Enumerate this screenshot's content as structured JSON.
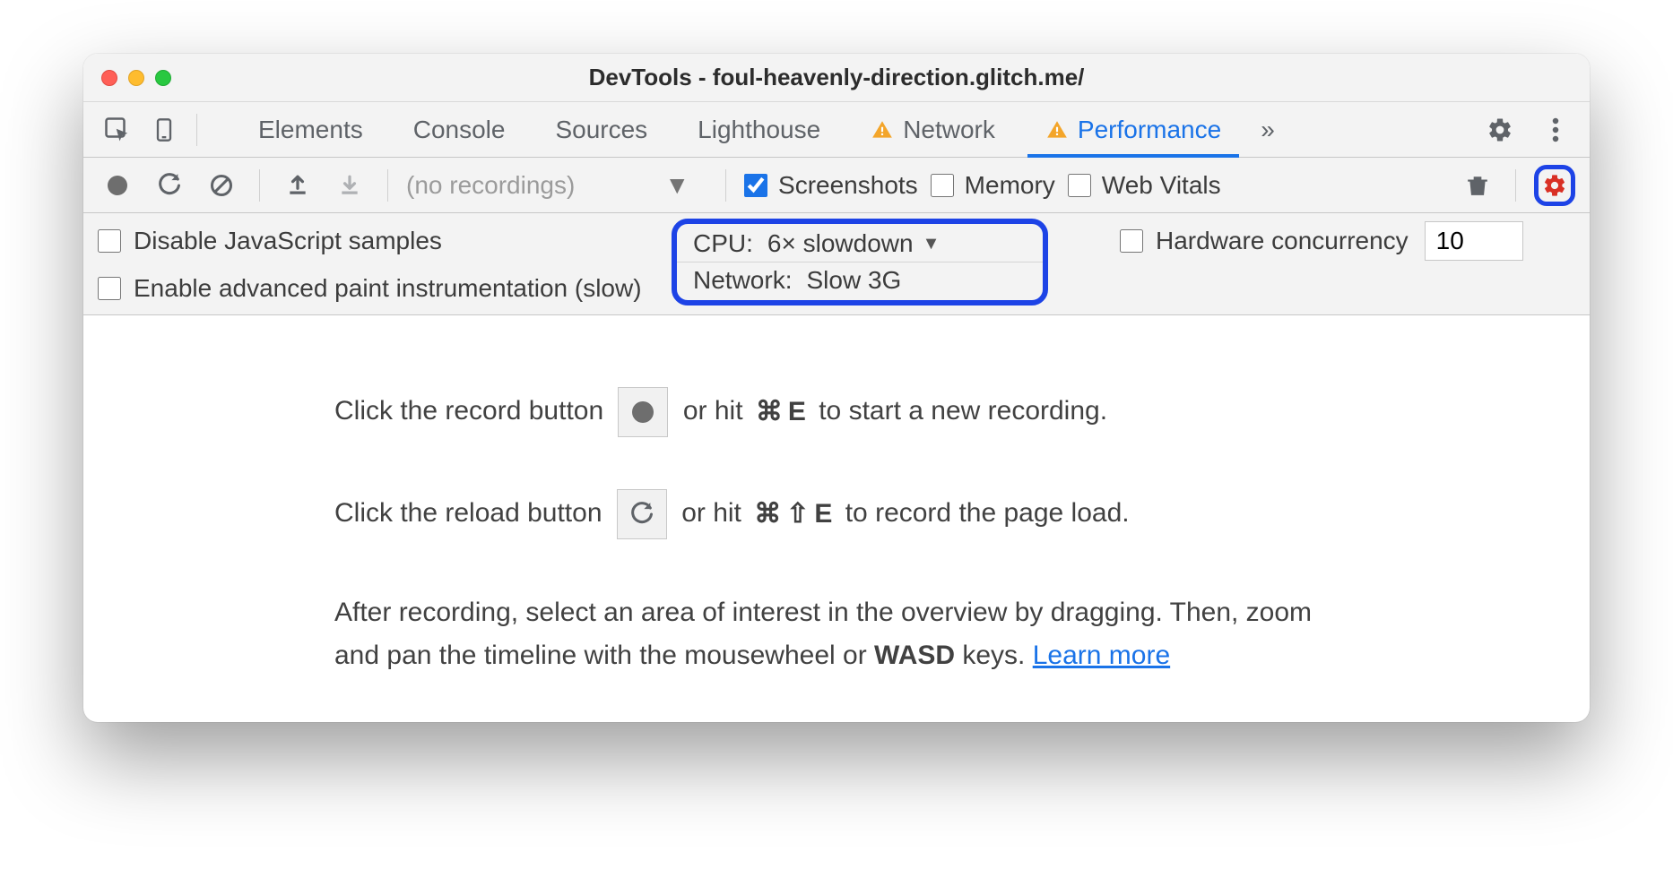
{
  "titlebar": {
    "title": "DevTools - foul-heavenly-direction.glitch.me/"
  },
  "tabs": {
    "items": [
      {
        "label": "Elements"
      },
      {
        "label": "Console"
      },
      {
        "label": "Sources"
      },
      {
        "label": "Lighthouse"
      },
      {
        "label": "Network",
        "warn": true
      },
      {
        "label": "Performance",
        "warn": true,
        "active": true
      }
    ],
    "more_glyph": "»"
  },
  "toolbar": {
    "no_recordings": "(no recordings)",
    "screenshots_label": "Screenshots",
    "memory_label": "Memory",
    "webvitals_label": "Web Vitals"
  },
  "throttling": {
    "disable_js_label": "Disable JavaScript samples",
    "paint_label": "Enable advanced paint instrumentation (slow)",
    "cpu_label": "CPU:",
    "cpu_value": "6× slowdown",
    "network_label": "Network:",
    "network_value": "Slow 3G",
    "hw_label": "Hardware concurrency",
    "hw_value": "10"
  },
  "instructions": {
    "line1_a": "Click the record button ",
    "line1_b": " or hit ",
    "line1_c": " to start a new recording.",
    "line1_key": "E",
    "line2_a": "Click the reload button ",
    "line2_b": " or hit ",
    "line2_c": " to record the page load.",
    "line2_key": "E",
    "line3_a": "After recording, select an area of interest in the overview by dragging. Then, zoom and pan the timeline with the mousewheel or ",
    "line3_wasd": "WASD",
    "line3_b": " keys. ",
    "learn_more": "Learn more",
    "cmd_glyph": "⌘",
    "shift_glyph": "⇧"
  }
}
